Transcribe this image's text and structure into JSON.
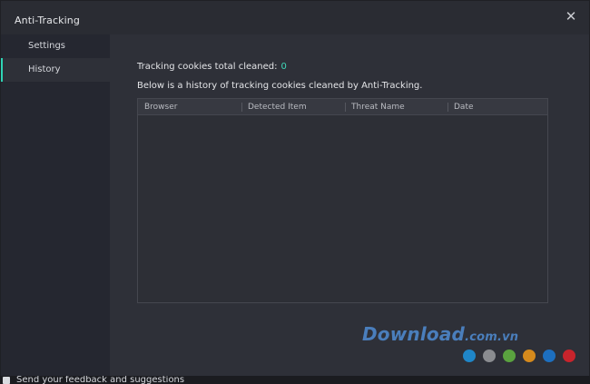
{
  "window": {
    "title": "Anti-Tracking",
    "close_icon": "close-icon"
  },
  "sidebar": {
    "items": [
      {
        "label": "Settings",
        "active": false
      },
      {
        "label": "History",
        "active": true
      }
    ],
    "accent_color": "#2fd3b5"
  },
  "history": {
    "total_label": "Tracking cookies total cleaned:",
    "total_count": "0",
    "description": "Below is a history of tracking cookies cleaned by Anti-Tracking.",
    "table": {
      "columns": [
        "Browser",
        "Detected Item",
        "Threat Name",
        "Date"
      ],
      "rows": []
    }
  },
  "watermark": {
    "main": "Download",
    "suffix": ".com.vn",
    "dot_colors": [
      "#1f86c8",
      "#8a8c90",
      "#5aa23f",
      "#d58a1d",
      "#1d6fbf",
      "#c8242c"
    ]
  },
  "footer": {
    "feedback_text": "Send your feedback and suggestions"
  }
}
